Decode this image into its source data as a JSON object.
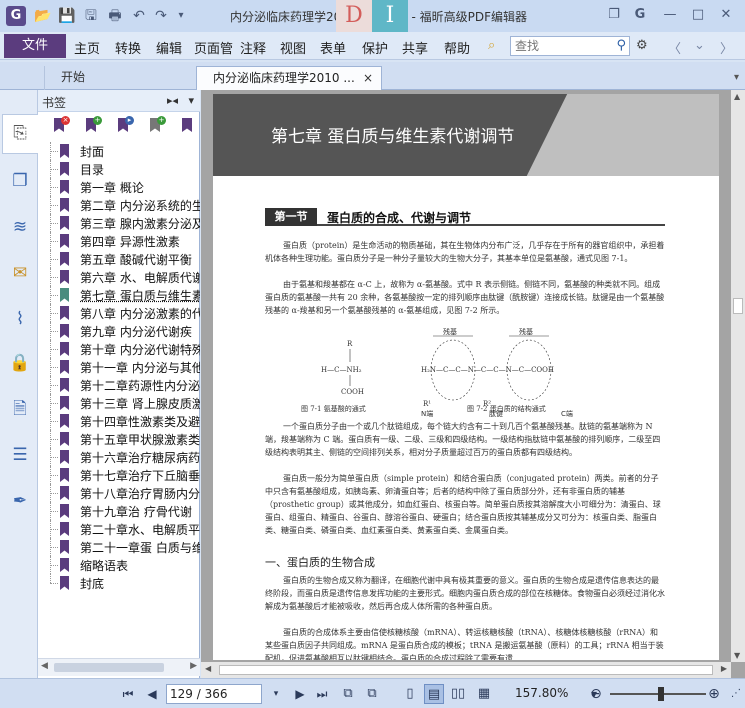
{
  "window": {
    "title": "内分泌临床药理学2010 书签.pdf - 福昕高级PDF编辑器",
    "logo": "G",
    "watermark_left": "D",
    "watermark_right": "I"
  },
  "quick_access": {
    "open": "📂",
    "save": "💾",
    "save_as": "🖫",
    "print": "🖶",
    "undo": "↶",
    "redo": "↷",
    "more": "▾"
  },
  "window_buttons": {
    "restore": "❐",
    "skin": "G",
    "minimize": "—",
    "maximize": "□",
    "close": "✕"
  },
  "menu": {
    "file": "文件",
    "items": [
      "主页",
      "转换",
      "编辑",
      "页面管",
      "注释",
      "视图",
      "表单",
      "保护",
      "共享",
      "帮助"
    ]
  },
  "search": {
    "placeholder": "查找",
    "icon": "⚲"
  },
  "menu_right_icons": {
    "settings": "⚙",
    "prev": "〈",
    "down": "⌄",
    "next": "〉"
  },
  "tabs": {
    "start": "开始",
    "document": "内分泌临床药理学2010 ...",
    "close": "×",
    "arrow": "▾"
  },
  "bookmarks": {
    "title": "书签",
    "collapse": "▸◂",
    "close": "▾",
    "items": [
      "封面",
      "目录",
      "第一章 概论",
      "第二章 内分泌系统的生",
      "第三章 腺内激素分泌及",
      "第四章 异源性激素",
      "第五章 酸碱代谢平衡",
      "第六章 水、电解质代谢",
      "第七章 蛋白质与维生素",
      "第八章 内分泌激素的代",
      "第九章 内分泌代谢疾",
      "第十章 内分泌代谢特殊",
      "第十一章 内分泌与其他",
      "第十二章药源性内分泌",
      "第十三章 肾上腺皮质激",
      "第十四章性激素类及避",
      "第十五章甲状腺激素类",
      "第十六章治疗糖尿病药",
      "第十七章治疗下丘脑垂",
      "第十八章治疗胃肠内分",
      "第十九章治 疗骨代谢",
      "第二十章水、电解质平",
      "第二十一章蛋 白质与维",
      "缩略语表",
      "封底"
    ],
    "selected_index": 8
  },
  "document": {
    "chapter": "第七章   蛋白质与维生素代谢调节",
    "section_tag": "第一节",
    "section_title": "蛋白质的合成、代谢与调节",
    "para1": "蛋白质（protein）是生命活动的物质基础，其在生物体内分布广泛，几乎存在于所有的器官组织中，承担着机体各种生理功能。蛋白质分子是一种分子量较大的生物大分子，其基本单位是氨基酸，通式见图 7-1。",
    "para2": "由于氨基和羧基都在 α-C 上，故称为 α-氨基酸。式中 R 表示侧链。侧链不同，氨基酸的种类就不同。组成蛋白质的氨基酸一共有 20 余种，各氨基酸按一定的排列顺序由肽键（酰胺键）连接成长链。肽键是由一个氨基酸残基的 α-羧基和另一个氨基酸残基的 α-氨基组成，见图 7-2 所示。",
    "fig_label_residue1": "残基",
    "fig_label_residue2": "残基",
    "fig_label_nterm": "N端",
    "fig_label_peptide": "肽键",
    "fig_label_cterm": "C端",
    "fig1_caption": "图 7-1   氨基酸的通式",
    "fig2_caption": "图 7-2   蛋白质的结构通式",
    "para3": "一个蛋白质分子由一个或几个肽链组成，每个链大约含有二十到几百个氨基酸残基。肽链的氨基端称为 N 端，羧基端称为 C 端。蛋白质有一级、二级、三级和四级结构。一级结构指肽链中氨基酸的排列顺序，二级至四级结构表明其主、侧链的空间排列关系，相对分子质量超过百万的蛋白质都有四级结构。",
    "para4": "蛋白质一般分为简单蛋白质（simple protein）和结合蛋白质（conjugated protein）两类。前者的分子中只含有氨基酸组成，如胰岛素、卵清蛋白等；后者的结构中除了蛋白质部分外，还有非蛋白质的辅基（prosthetic group）或其他成分，如血红蛋白、核蛋白等。简单蛋白质按其溶解度大小可细分为：清蛋白、球蛋白、组蛋白、精蛋白、谷蛋白、醇溶谷蛋白、硬蛋白；结合蛋白质按其辅基成分又可分为：核蛋白类、脂蛋白类、糖蛋白类、磷蛋白类、血红素蛋白类、黄素蛋白类、金属蛋白类。",
    "subhead": "一、蛋白质的生物合成",
    "para5": "蛋白质的生物合成又称为翻译，在细胞代谢中具有极其重要的意义。蛋白质的生物合成是遗传信息表达的最终阶段，而蛋白质是遗传信息发挥功能的主要形式。细胞内蛋白质合成的部位在核糖体。食物蛋白必须经过消化水解成为氨基酸后才能被吸收，然后再合成人体所需的各种蛋白质。",
    "para6": "蛋白质的合成体系主要由信使核糖核酸（mRNA）、转运核糖核酸（tRNA）、核糖体核糖核酸（rRNA）和某些蛋白质因子共同组成。mRNA 是蛋白质合成的模板；tRNA 是搬运氨基酸（原料）的工具；rRNA 相当于装配机，促进氨基酸相互以肽键相结合。蛋白质的合成过程除了需要有遗"
  },
  "status": {
    "first": "⏮",
    "prev": "◀",
    "next": "▶",
    "last": "⏭",
    "page_current": "129 / 366",
    "page_total": "",
    "zoom": "157.80%",
    "zoom_out": "⊖",
    "zoom_in": "⊕"
  }
}
